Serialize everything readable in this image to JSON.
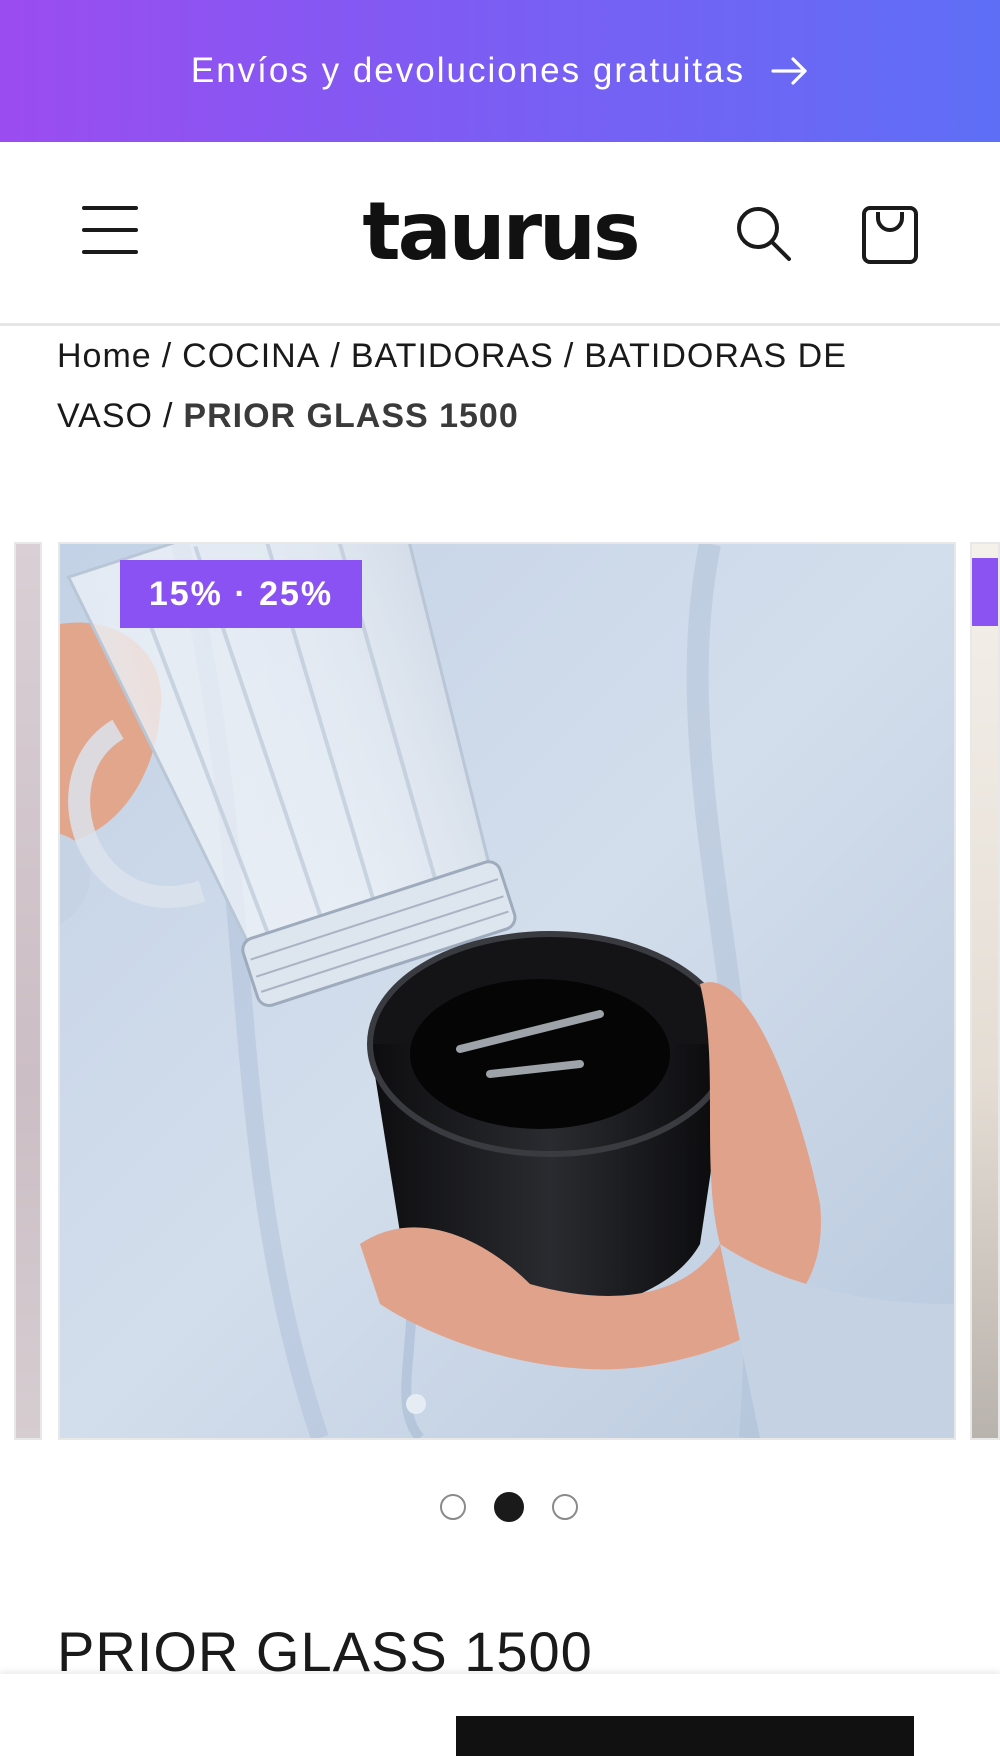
{
  "announcement": {
    "text": "Envíos y devoluciones gratuitas",
    "icon": "arrow-right-icon"
  },
  "header": {
    "logo_text": "taurus",
    "menu_icon": "hamburger-menu-icon",
    "search_icon": "search-icon",
    "cart_icon": "shopping-bag-icon"
  },
  "breadcrumb": {
    "items": [
      "Home",
      "COCINA",
      "BATIDORAS",
      "BATIDORAS DE VASO"
    ],
    "separator": "/",
    "current": "PRIOR GLASS 1500"
  },
  "gallery": {
    "badge": "15% · 25%",
    "slide_count": 3,
    "active_slide": 2
  },
  "product": {
    "title": "PRIOR GLASS 1500"
  },
  "colors": {
    "accent": "#8a52f3",
    "gradient_start": "#9b4cf0",
    "gradient_end": "#5e6ff6"
  }
}
